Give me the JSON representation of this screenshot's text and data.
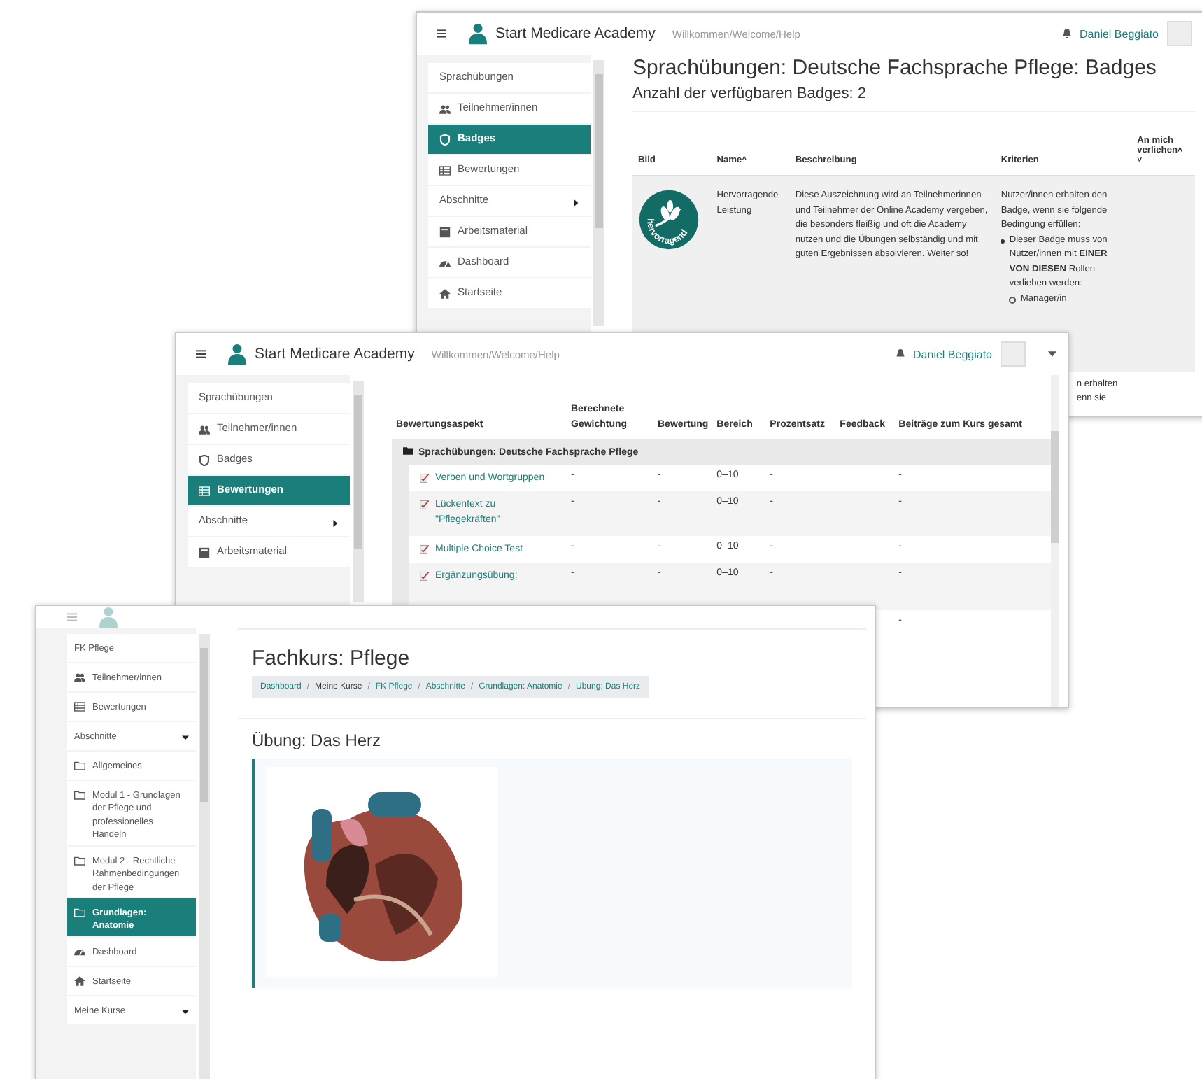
{
  "windows": [
    {
      "kind": "badges",
      "header": {
        "brand": "Start Medicare Academy",
        "welcome": "Willkommen/Welcome/Help",
        "user": "Daniel Beggiato"
      },
      "sidebar": {
        "items": [
          {
            "label": "Sprachübungen",
            "kind": "course",
            "selected": false
          },
          {
            "label": "Teilnehmer/innen",
            "kind": "participants",
            "selected": false
          },
          {
            "label": "Badges",
            "kind": "badges",
            "selected": true
          },
          {
            "label": "Bewertungen",
            "kind": "grades",
            "selected": false
          },
          {
            "label": "Abschnitte",
            "kind": "sections",
            "expanded": false,
            "selected": false
          },
          {
            "label": "Arbeitsmaterial",
            "kind": "materials",
            "selected": false
          },
          {
            "label": "Dashboard",
            "kind": "dashboard",
            "selected": false
          },
          {
            "label": "Startseite",
            "kind": "home",
            "selected": false
          }
        ]
      },
      "title": "Sprachübungen: Deutsche Fachsprache Pflege: Badges",
      "subtitle": "Anzahl der verfügbaren Badges: 2",
      "table": {
        "columns": [
          {
            "label": "Bild"
          },
          {
            "label": "Name",
            "sort": "^"
          },
          {
            "label": "Beschreibung"
          },
          {
            "label": "Kriterien"
          },
          {
            "label": "An mich verliehen",
            "sort": "˄ ˅"
          }
        ],
        "rows": [
          {
            "badge_label": "hervorragend",
            "name": "Hervorragende Leistung",
            "description": "Diese Auszeichnung wird an Teilnehmerinnen und Teilnehmer der Online Academy vergeben, die besonders fleißig und oft die Academy nutzen und die Übungen selbständig und mit guten Ergebnissen absolvieren. Weiter so!",
            "criteria": [
              "Nutzer/innen erhalten den Badge, wenn sie folgende Bedingung erfüllen:"
            ],
            "bullets": [
              "Dieser Badge muss von Nutzer/innen mit **EINER VON DIESEN** Rollen verliehen werden:"
            ],
            "sub_bullets": [
              "Manager/in"
            ]
          },
          {
            "criteria": [
              "n erhalten",
              "enn sie"
            ]
          }
        ]
      }
    },
    {
      "kind": "grades",
      "header": {
        "brand": "Start Medicare Academy",
        "welcome": "Willkommen/Welcome/Help",
        "user": "Daniel Beggiato",
        "user_menu": true
      },
      "sidebar": {
        "items": [
          {
            "label": "Sprachübungen",
            "kind": "course",
            "selected": false
          },
          {
            "label": "Teilnehmer/innen",
            "kind": "participants",
            "selected": false
          },
          {
            "label": "Badges",
            "kind": "badges",
            "selected": false
          },
          {
            "label": "Bewertungen",
            "kind": "grades",
            "selected": true
          },
          {
            "label": "Abschnitte",
            "kind": "sections",
            "expanded": false,
            "selected": false
          },
          {
            "label": "Arbeitsmaterial",
            "kind": "materials",
            "selected": false
          }
        ]
      },
      "table": {
        "columns": [
          "Bewertungsaspekt",
          "Berechnete Gewichtung",
          "Bewertung",
          "Bereich",
          "Prozentsatz",
          "Feedback",
          "Beiträge zum Kurs gesamt"
        ],
        "category": "Sprachübungen: Deutsche Fachsprache Pflege",
        "rows": [
          {
            "name": "Verben und Wortgruppen",
            "weight": "-",
            "grade": "-",
            "range": "0–10",
            "percent": "-",
            "total": "-"
          },
          {
            "name": "Lückentext zu \"Pflegekräften\"",
            "weight": "-",
            "grade": "-",
            "range": "0–10",
            "percent": "-",
            "total": "-"
          },
          {
            "name": "Multiple Choice Test",
            "weight": "-",
            "grade": "-",
            "range": "0–10",
            "percent": "-",
            "total": "-"
          },
          {
            "name": "Ergänzungsübung:",
            "weight": "-",
            "grade": "-",
            "range": "0–10",
            "percent": "-",
            "total": "-"
          },
          {
            "total": "-"
          }
        ]
      }
    },
    {
      "kind": "course",
      "sidebar": {
        "items": [
          {
            "label": "FK Pflege",
            "kind": "course",
            "selected": false
          },
          {
            "label": "Teilnehmer/innen",
            "kind": "participants",
            "selected": false
          },
          {
            "label": "Bewertungen",
            "kind": "grades",
            "selected": false
          },
          {
            "label": "Abschnitte",
            "kind": "sections",
            "expanded": true,
            "selected": false
          },
          {
            "label": "Allgemeines",
            "kind": "folder",
            "selected": false
          },
          {
            "label": "Modul 1 - Grundlagen der Pflege und professionelles Handeln",
            "kind": "folder",
            "selected": false
          },
          {
            "label": "Modul 2 - Rechtliche Rahmenbedingungen der Pflege",
            "kind": "folder",
            "selected": false
          },
          {
            "label": "Grundlagen: Anatomie",
            "kind": "folder",
            "selected": true
          },
          {
            "label": "Dashboard",
            "kind": "dashboard",
            "selected": false
          },
          {
            "label": "Startseite",
            "kind": "home",
            "selected": false
          },
          {
            "label": "Meine Kurse",
            "kind": "sections",
            "expanded": true,
            "selected": false
          }
        ]
      },
      "title": "Fachkurs: Pflege",
      "breadcrumb_separator": "/",
      "breadcrumb": [
        {
          "label": "Dashboard",
          "link": true
        },
        {
          "label": "Meine Kurse",
          "link": false
        },
        {
          "label": "FK Pflege",
          "link": true
        },
        {
          "label": "Abschnitte",
          "link": true
        },
        {
          "label": "Grundlagen: Anatomie",
          "link": true
        },
        {
          "label": "Übung: Das Herz",
          "link": true
        }
      ],
      "section_title": "Übung: Das Herz",
      "image": {
        "kind": "picture"
      }
    }
  ]
}
